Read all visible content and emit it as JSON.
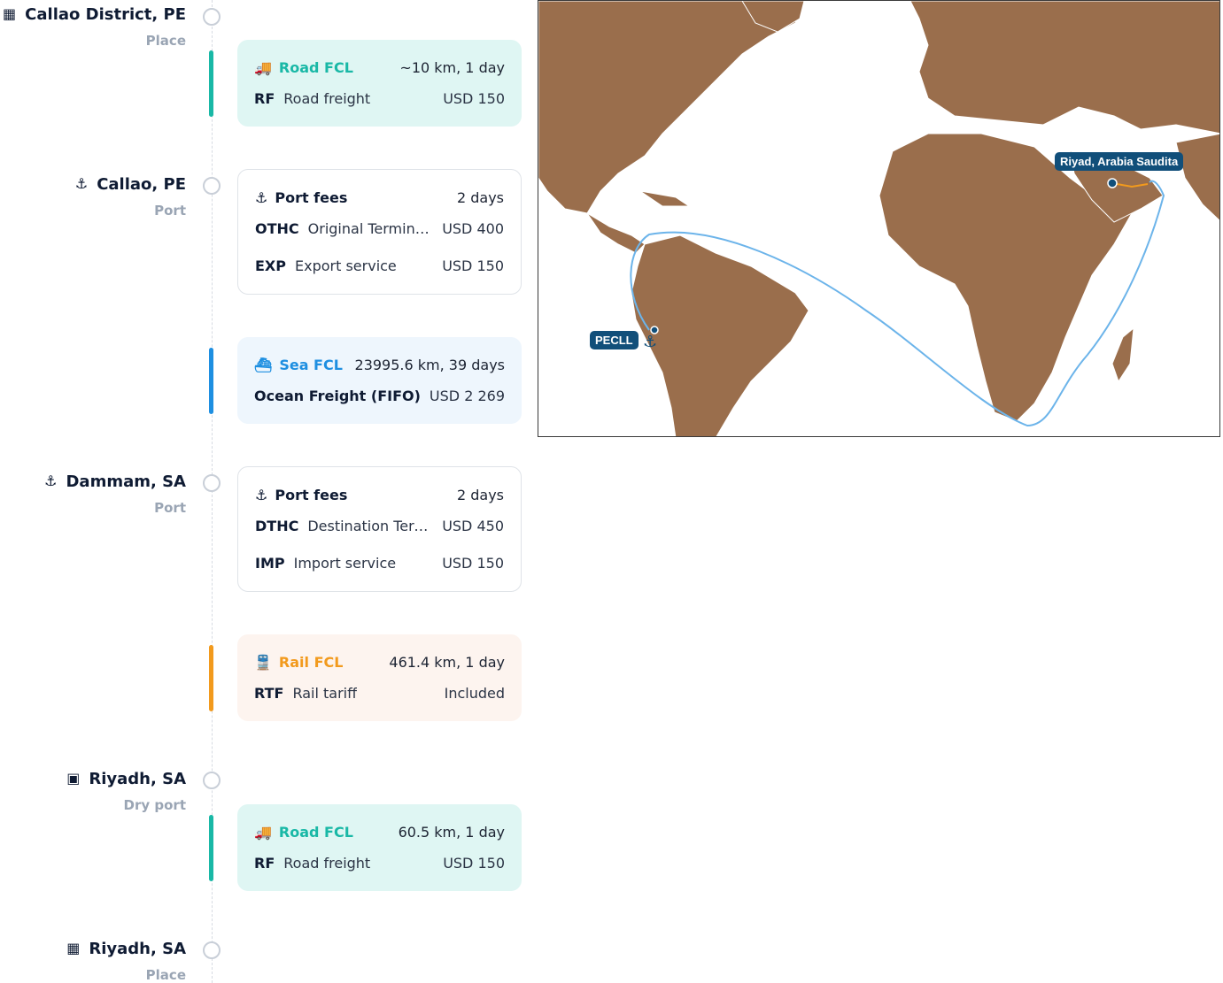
{
  "stops": [
    {
      "name": "Callao District, PE",
      "kind": "Place",
      "icon": "building-icon",
      "glyph": "▦"
    },
    {
      "name": "Callao, PE",
      "kind": "Port",
      "icon": "anchor-icon",
      "glyph": "⚓"
    },
    {
      "name": "Dammam, SA",
      "kind": "Port",
      "icon": "anchor-icon",
      "glyph": "⚓"
    },
    {
      "name": "Riyadh, SA",
      "kind": "Dry port",
      "icon": "warehouse-icon",
      "glyph": "▣"
    },
    {
      "name": "Riyadh, SA",
      "kind": "Place",
      "icon": "building-icon",
      "glyph": "▦"
    }
  ],
  "legs": {
    "road1": {
      "mode": "Road FCL",
      "summary": "~10 km, 1 day",
      "icon": "truck-icon",
      "items": [
        {
          "code": "RF",
          "desc": "Road freight",
          "amount": "USD 150"
        }
      ]
    },
    "port1": {
      "title": "Port fees",
      "summary": "2 days",
      "icon": "anchor-icon",
      "items": [
        {
          "code": "OTHC",
          "desc": "Original Terminal Handling Charge",
          "amount": "USD 400"
        },
        {
          "code": "EXP",
          "desc": "Export service",
          "amount": "USD 150"
        }
      ]
    },
    "sea": {
      "mode": "Sea FCL",
      "summary": "23995.6 km, 39 days",
      "icon": "ship-icon",
      "items": [
        {
          "code": "",
          "desc": "Ocean Freight (FIFO)",
          "amount": "USD 2 269"
        }
      ]
    },
    "port2": {
      "title": "Port fees",
      "summary": "2 days",
      "icon": "anchor-icon",
      "items": [
        {
          "code": "DTHC",
          "desc": "Destination Terminal Handling Charge",
          "amount": "USD 450"
        },
        {
          "code": "IMP",
          "desc": "Import service",
          "amount": "USD 150"
        }
      ]
    },
    "rail": {
      "mode": "Rail FCL",
      "summary": "461.4 km, 1 day",
      "icon": "train-icon",
      "items": [
        {
          "code": "RTF",
          "desc": "Rail tariff",
          "amount": "Included"
        }
      ]
    },
    "road2": {
      "mode": "Road FCL",
      "summary": "60.5 km, 1 day",
      "icon": "truck-icon",
      "items": [
        {
          "code": "RF",
          "desc": "Road freight",
          "amount": "USD 150"
        }
      ]
    }
  },
  "map": {
    "origin_label": "PECLL",
    "destination_label": "Riyad, Arabia Saudita"
  },
  "colors": {
    "road": "#19b8a6",
    "sea": "#1e8fe1",
    "rail": "#f29a1d",
    "land": "#9a6e4c",
    "route": "#6cb4ea",
    "tag": "#114f7a"
  }
}
